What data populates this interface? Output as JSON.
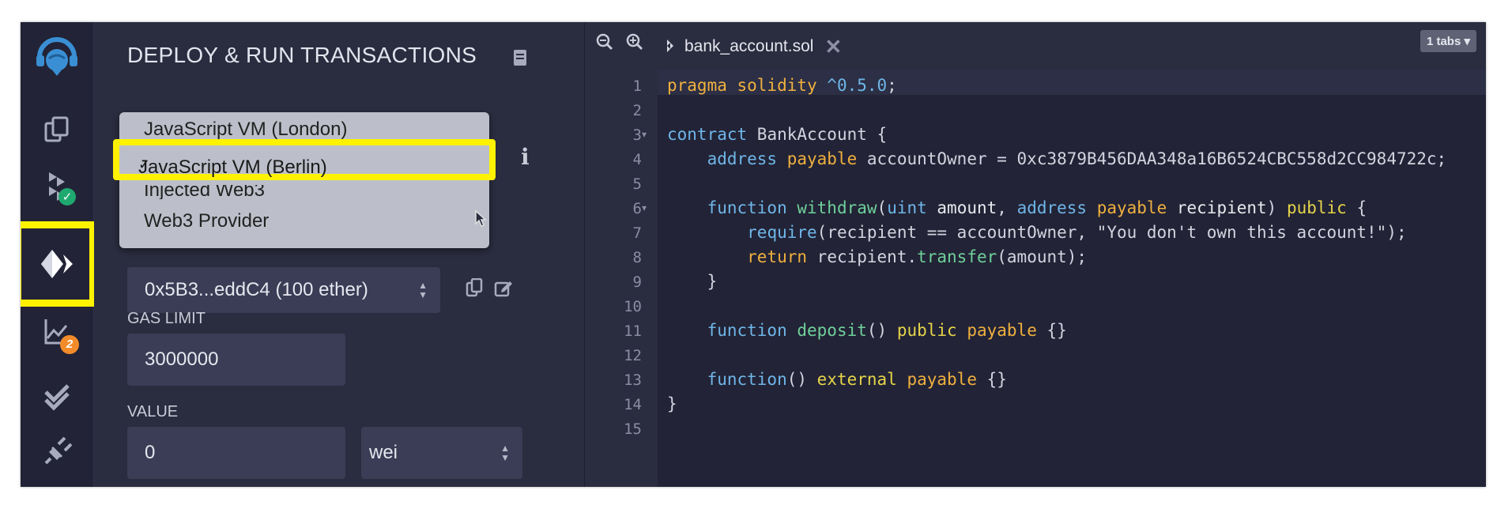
{
  "panel": {
    "title": "DEPLOY & RUN TRANSACTIONS",
    "environment_options": [
      "JavaScript VM (London)",
      "JavaScript VM (Berlin)",
      "Injected Web3",
      "Web3 Provider"
    ],
    "environment_selected": "JavaScript VM (Berlin)",
    "account": "0x5B3...eddC4 (100 ether)",
    "gas_limit_label": "GAS LIMIT",
    "gas_limit_value": "3000000",
    "value_label": "VALUE",
    "value_amount": "0",
    "value_unit": "wei"
  },
  "rail": {
    "analysis_badge_count": "2"
  },
  "editor": {
    "tab_name": "bank_account.sol",
    "tabs_count": "1 tabs",
    "line_numbers": [
      "1",
      "2",
      "3",
      "4",
      "5",
      "6",
      "7",
      "8",
      "9",
      "10",
      "11",
      "12",
      "13",
      "14",
      "15"
    ]
  },
  "colors": {
    "highlight": "#fff200",
    "keyword_orange": "#f0b03f",
    "keyword_yellow": "#e6d54a",
    "keyword_blue": "#6fb6e8",
    "function_green": "#6fd09a"
  }
}
